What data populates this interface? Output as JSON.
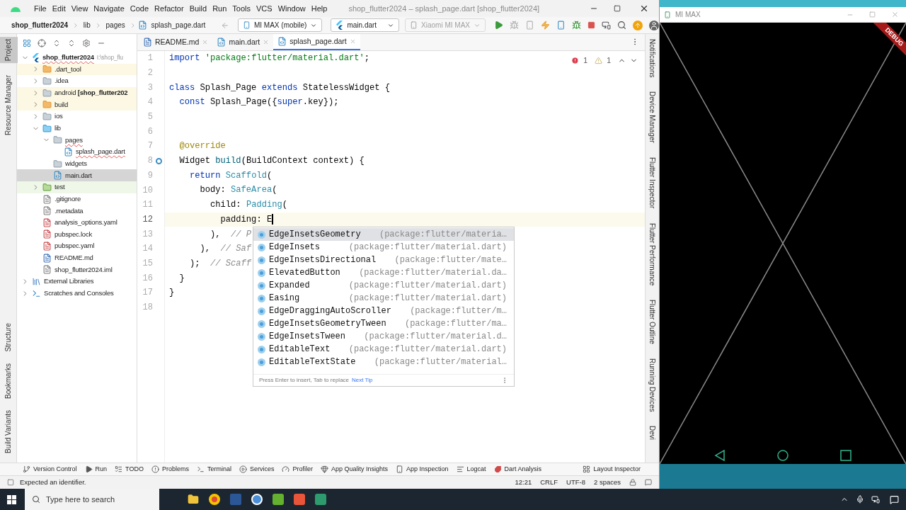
{
  "ide": {
    "menu": [
      "File",
      "Edit",
      "View",
      "Navigate",
      "Code",
      "Refactor",
      "Build",
      "Run",
      "Tools",
      "VCS",
      "Window",
      "Help"
    ],
    "title": "shop_flutter2024 – splash_page.dart [shop_flutter2024]",
    "breadcrumbs": [
      "shop_flutter2024",
      "lib",
      "pages",
      "splash_page.dart"
    ],
    "device_selector": "MI MAX (mobile)",
    "run_config": "main.dart",
    "target": {
      "label": "Xiaomi MI MAX",
      "disabled": true
    },
    "left_strip_top": [
      {
        "label": "Project",
        "selected": true
      },
      {
        "label": "Resource Manager",
        "selected": false
      }
    ],
    "left_strip_bottom": [
      {
        "label": "Structure",
        "selected": false
      },
      {
        "label": "Bookmarks",
        "selected": false
      },
      {
        "label": "Build Variants",
        "selected": false
      }
    ],
    "project_tree": [
      {
        "label": "shop_flutter2024",
        "path": "I:\\shop_flu",
        "kind": "flutter",
        "expanded": true,
        "selected": false,
        "error": true,
        "children": [
          {
            "label": ".dart_tool",
            "kind": "folder-orange",
            "expanded": false,
            "selected": false,
            "error": false,
            "color": "#fcf8e3"
          },
          {
            "label": ".idea",
            "kind": "folder",
            "expanded": false,
            "selected": false,
            "error": false
          },
          {
            "label": "android **[shop_flutter202**",
            "kind": "folder",
            "expanded": false,
            "selected": false,
            "error": false,
            "color": "#fcf8e3"
          },
          {
            "label": "build",
            "kind": "folder-orange",
            "expanded": false,
            "selected": false,
            "error": false,
            "color": "#fcf8e3"
          },
          {
            "label": "ios",
            "kind": "folder",
            "expanded": false,
            "selected": false,
            "error": false
          },
          {
            "label": "lib",
            "kind": "folder-blue",
            "expanded": true,
            "selected": false,
            "error": false,
            "children": [
              {
                "label": "pages",
                "kind": "folder",
                "expanded": true,
                "selected": false,
                "error": true,
                "children": [
                  {
                    "label": "splash_page.dart",
                    "kind": "dart",
                    "selected": false,
                    "error": true
                  }
                ]
              },
              {
                "label": "widgets",
                "kind": "folder",
                "selected": false,
                "error": false
              },
              {
                "label": "main.dart",
                "kind": "dart",
                "selected": true,
                "error": false
              }
            ]
          },
          {
            "label": "test",
            "kind": "folder-green",
            "expanded": false,
            "selected": false,
            "error": false,
            "color": "#eff7e9"
          },
          {
            "label": ".gitignore",
            "kind": "file",
            "selected": false,
            "error": false
          },
          {
            "label": ".metadata",
            "kind": "file",
            "selected": false,
            "error": false
          },
          {
            "label": "analysis_options.yaml",
            "kind": "yaml",
            "selected": false,
            "error": false
          },
          {
            "label": "pubspec.lock",
            "kind": "yaml",
            "selected": false,
            "error": false
          },
          {
            "label": "pubspec.yaml",
            "kind": "yaml",
            "selected": false,
            "error": false
          },
          {
            "label": "README.md",
            "kind": "md",
            "selected": false,
            "error": false
          },
          {
            "label": "shop_flutter2024.iml",
            "kind": "file",
            "selected": false,
            "error": false
          }
        ]
      },
      {
        "label": "External Libraries",
        "kind": "library",
        "expanded": false,
        "selected": false,
        "error": false
      },
      {
        "label": "Scratches and Consoles",
        "kind": "scratch",
        "expanded": false,
        "selected": false,
        "error": false
      }
    ],
    "tabs": [
      {
        "label": "README.md",
        "kind": "md",
        "selected": false
      },
      {
        "label": "main.dart",
        "kind": "dart",
        "selected": false
      },
      {
        "label": "splash_page.dart",
        "kind": "dart",
        "selected": true
      }
    ],
    "inspections": {
      "errors": "1",
      "warnings": "1"
    },
    "code_lines": [
      {
        "number": "1",
        "current": false,
        "tokens": [
          {
            "t": "import ",
            "kind": "kw"
          },
          {
            "t": "'package:flutter/material.dart'",
            "kind": "str"
          },
          {
            "t": ";",
            "kind": "plain"
          }
        ]
      },
      {
        "number": "2",
        "current": false
      },
      {
        "number": "3",
        "current": false,
        "tokens": [
          {
            "t": "class ",
            "kind": "kw"
          },
          {
            "t": "Splash_Page ",
            "kind": "plain"
          },
          {
            "t": "extends ",
            "kind": "kw"
          },
          {
            "t": "StatelessWidget {",
            "kind": "plain"
          }
        ]
      },
      {
        "number": "4",
        "current": false,
        "tokens": [
          {
            "t": "  const ",
            "kind": "kw"
          },
          {
            "t": "Splash_Page({",
            "kind": "plain"
          },
          {
            "t": "super",
            "kind": "kw"
          },
          {
            "t": ".key});",
            "kind": "plain"
          }
        ]
      },
      {
        "number": "5",
        "current": false
      },
      {
        "number": "6",
        "current": false
      },
      {
        "number": "7",
        "current": false,
        "tokens": [
          {
            "t": "  @override",
            "kind": "ann"
          }
        ]
      },
      {
        "number": "8",
        "current": false,
        "override": true,
        "tokens": [
          {
            "t": "  Widget ",
            "kind": "plain"
          },
          {
            "t": "build",
            "kind": "fn"
          },
          {
            "t": "(BuildContext context) {",
            "kind": "plain"
          }
        ]
      },
      {
        "number": "9",
        "current": false,
        "tokens": [
          {
            "t": "    return ",
            "kind": "kw"
          },
          {
            "t": "Scaffold",
            "kind": "cls"
          },
          {
            "t": "(",
            "kind": "plain"
          }
        ]
      },
      {
        "number": "10",
        "current": false,
        "tokens": [
          {
            "t": "      body: ",
            "kind": "plain"
          },
          {
            "t": "SafeArea",
            "kind": "cls"
          },
          {
            "t": "(",
            "kind": "plain"
          }
        ]
      },
      {
        "number": "11",
        "current": false,
        "tokens": [
          {
            "t": "        child: ",
            "kind": "plain"
          },
          {
            "t": "Padding",
            "kind": "cls"
          },
          {
            "t": "(",
            "kind": "plain"
          }
        ]
      },
      {
        "number": "12",
        "current": true,
        "tokens": [
          {
            "t": "          padding: E",
            "kind": "plain"
          }
        ]
      },
      {
        "number": "13",
        "current": false,
        "tokens": [
          {
            "t": "        ),  ",
            "kind": "plain"
          },
          {
            "t": "// P",
            "kind": "comment"
          }
        ]
      },
      {
        "number": "14",
        "current": false,
        "tokens": [
          {
            "t": "      ),  ",
            "kind": "plain"
          },
          {
            "t": "// Saf",
            "kind": "comment"
          }
        ]
      },
      {
        "number": "15",
        "current": false,
        "tokens": [
          {
            "t": "    );  ",
            "kind": "plain"
          },
          {
            "t": "// Scaff",
            "kind": "comment"
          }
        ]
      },
      {
        "number": "16",
        "current": false,
        "tokens": [
          {
            "t": "  }",
            "kind": "plain"
          }
        ]
      },
      {
        "number": "17",
        "current": false,
        "tokens": [
          {
            "t": "}",
            "kind": "plain"
          }
        ]
      },
      {
        "number": "18",
        "current": false
      }
    ],
    "completion": {
      "items": [
        {
          "name": "EdgeInsetsGeometry",
          "package": "(package:flutter/materia…",
          "selected": true
        },
        {
          "name": "EdgeInsets",
          "package": "(package:flutter/material.dart)",
          "selected": false
        },
        {
          "name": "EdgeInsetsDirectional",
          "package": "(package:flutter/mate…",
          "selected": false
        },
        {
          "name": "ElevatedButton",
          "package": "(package:flutter/material.da…",
          "selected": false
        },
        {
          "name": "Expanded",
          "package": "(package:flutter/material.dart)",
          "selected": false
        },
        {
          "name": "Easing",
          "package": "(package:flutter/material.dart)",
          "selected": false
        },
        {
          "name": "EdgeDraggingAutoScroller",
          "package": "(package:flutter/m…",
          "selected": false
        },
        {
          "name": "EdgeInsetsGeometryTween",
          "package": "(package:flutter/ma…",
          "selected": false
        },
        {
          "name": "EdgeInsetsTween",
          "package": "(package:flutter/material.d…",
          "selected": false
        },
        {
          "name": "EditableText",
          "package": "(package:flutter/material.dart)",
          "selected": false
        },
        {
          "name": "EditableTextState",
          "package": "(package:flutter/material…",
          "selected": false
        }
      ],
      "hint": "Press Enter to insert, Tab to replace",
      "tip": "Next Tip"
    },
    "right_strip": [
      "Notifications",
      "Device Manager",
      "Flutter Inspector",
      "Flutter Performance",
      "Flutter Outline",
      "Running Devices",
      "Devi"
    ],
    "tool_windows": [
      {
        "label": "Version Control",
        "kind": "vcs"
      },
      {
        "label": "Run",
        "kind": "run"
      },
      {
        "label": "TODO",
        "kind": "todo"
      },
      {
        "label": "Problems",
        "kind": "problems"
      },
      {
        "label": "Terminal",
        "kind": "terminal"
      },
      {
        "label": "Services",
        "kind": "services"
      },
      {
        "label": "Profiler",
        "kind": "profiler"
      },
      {
        "label": "App Quality Insights",
        "kind": "insights"
      },
      {
        "label": "App Inspection",
        "kind": "inspection"
      },
      {
        "label": "Logcat",
        "kind": "logcat"
      },
      {
        "label": "Dart Analysis",
        "kind": "dart"
      }
    ],
    "layout_inspector": "Layout Inspector",
    "status": {
      "message": "Expected an identifier.",
      "position": "12:21",
      "line_separator": "CRLF",
      "encoding": "UTF-8",
      "indent": "2 spaces"
    }
  },
  "emulator": {
    "title": "MI MAX",
    "banner": "DEBUG"
  },
  "taskbar": {
    "search_placeholder": "Type here to search"
  }
}
